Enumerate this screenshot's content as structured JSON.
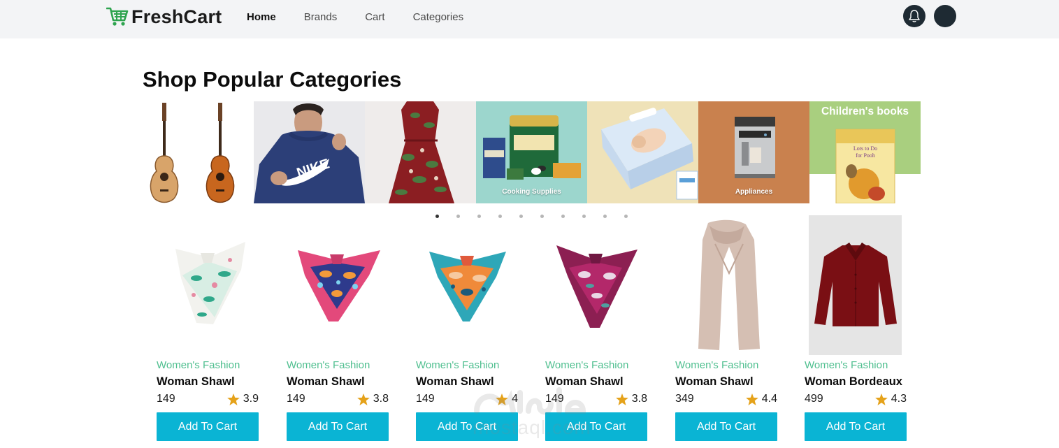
{
  "brand": {
    "name": "FreshCart",
    "accent": "#2ea44f"
  },
  "nav": {
    "links": [
      {
        "label": "Home",
        "active": true
      },
      {
        "label": "Brands",
        "active": false
      },
      {
        "label": "Cart",
        "active": false
      },
      {
        "label": "Categories",
        "active": false
      }
    ],
    "icons": [
      "bell-icon",
      "user-avatar"
    ]
  },
  "section": {
    "title": "Shop Popular Categories"
  },
  "categories": [
    {
      "name": "guitars",
      "caption": ""
    },
    {
      "name": "men-hoodie",
      "caption": ""
    },
    {
      "name": "women-dress",
      "caption": ""
    },
    {
      "name": "cooking-supplies",
      "caption": "Cooking Supplies"
    },
    {
      "name": "baby-diapers",
      "caption": ""
    },
    {
      "name": "appliances",
      "caption": "Appliances"
    },
    {
      "name": "childrens-books",
      "caption": "Children's books",
      "book_text": "Lots to Do for Pooh"
    }
  ],
  "slider_dots": {
    "count": 10,
    "active_index": 0
  },
  "products": [
    {
      "category": "Women's Fashion",
      "title": "Woman Shawl",
      "price": "149",
      "rating": "3.9",
      "button": "Add To Cart"
    },
    {
      "category": "Women's Fashion",
      "title": "Woman Shawl",
      "price": "149",
      "rating": "3.8",
      "button": "Add To Cart"
    },
    {
      "category": "Women's Fashion",
      "title": "Woman Shawl",
      "price": "149",
      "rating": "4",
      "button": "Add To Cart"
    },
    {
      "category": "Women's Fashion",
      "title": "Woman Shawl",
      "price": "149",
      "rating": "3.8",
      "button": "Add To Cart"
    },
    {
      "category": "Women's Fashion",
      "title": "Woman Shawl",
      "price": "349",
      "rating": "4.4",
      "button": "Add To Cart"
    },
    {
      "category": "Women's Fashion",
      "title": "Woman Bordeaux",
      "price": "499",
      "rating": "4.3",
      "button": "Add To Cart"
    }
  ],
  "colors": {
    "primary_button": "#0ab4d4",
    "category_text": "#4fbf8f",
    "star": "#e5a21a",
    "navbar_bg": "#f3f4f6"
  },
  "watermark": {
    "arabic": "مستقل",
    "latin": "mostaql.com"
  }
}
